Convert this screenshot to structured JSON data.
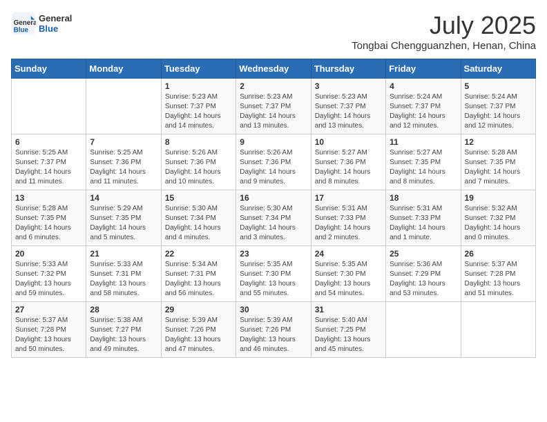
{
  "header": {
    "logo_general": "General",
    "logo_blue": "Blue",
    "month_title": "July 2025",
    "location": "Tongbai Chengguanzhen, Henan, China"
  },
  "weekdays": [
    "Sunday",
    "Monday",
    "Tuesday",
    "Wednesday",
    "Thursday",
    "Friday",
    "Saturday"
  ],
  "weeks": [
    [
      {
        "day": "",
        "info": ""
      },
      {
        "day": "",
        "info": ""
      },
      {
        "day": "1",
        "info": "Sunrise: 5:23 AM\nSunset: 7:37 PM\nDaylight: 14 hours and 14 minutes."
      },
      {
        "day": "2",
        "info": "Sunrise: 5:23 AM\nSunset: 7:37 PM\nDaylight: 14 hours and 13 minutes."
      },
      {
        "day": "3",
        "info": "Sunrise: 5:23 AM\nSunset: 7:37 PM\nDaylight: 14 hours and 13 minutes."
      },
      {
        "day": "4",
        "info": "Sunrise: 5:24 AM\nSunset: 7:37 PM\nDaylight: 14 hours and 12 minutes."
      },
      {
        "day": "5",
        "info": "Sunrise: 5:24 AM\nSunset: 7:37 PM\nDaylight: 14 hours and 12 minutes."
      }
    ],
    [
      {
        "day": "6",
        "info": "Sunrise: 5:25 AM\nSunset: 7:37 PM\nDaylight: 14 hours and 11 minutes."
      },
      {
        "day": "7",
        "info": "Sunrise: 5:25 AM\nSunset: 7:36 PM\nDaylight: 14 hours and 11 minutes."
      },
      {
        "day": "8",
        "info": "Sunrise: 5:26 AM\nSunset: 7:36 PM\nDaylight: 14 hours and 10 minutes."
      },
      {
        "day": "9",
        "info": "Sunrise: 5:26 AM\nSunset: 7:36 PM\nDaylight: 14 hours and 9 minutes."
      },
      {
        "day": "10",
        "info": "Sunrise: 5:27 AM\nSunset: 7:36 PM\nDaylight: 14 hours and 8 minutes."
      },
      {
        "day": "11",
        "info": "Sunrise: 5:27 AM\nSunset: 7:35 PM\nDaylight: 14 hours and 8 minutes."
      },
      {
        "day": "12",
        "info": "Sunrise: 5:28 AM\nSunset: 7:35 PM\nDaylight: 14 hours and 7 minutes."
      }
    ],
    [
      {
        "day": "13",
        "info": "Sunrise: 5:28 AM\nSunset: 7:35 PM\nDaylight: 14 hours and 6 minutes."
      },
      {
        "day": "14",
        "info": "Sunrise: 5:29 AM\nSunset: 7:35 PM\nDaylight: 14 hours and 5 minutes."
      },
      {
        "day": "15",
        "info": "Sunrise: 5:30 AM\nSunset: 7:34 PM\nDaylight: 14 hours and 4 minutes."
      },
      {
        "day": "16",
        "info": "Sunrise: 5:30 AM\nSunset: 7:34 PM\nDaylight: 14 hours and 3 minutes."
      },
      {
        "day": "17",
        "info": "Sunrise: 5:31 AM\nSunset: 7:33 PM\nDaylight: 14 hours and 2 minutes."
      },
      {
        "day": "18",
        "info": "Sunrise: 5:31 AM\nSunset: 7:33 PM\nDaylight: 14 hours and 1 minute."
      },
      {
        "day": "19",
        "info": "Sunrise: 5:32 AM\nSunset: 7:32 PM\nDaylight: 14 hours and 0 minutes."
      }
    ],
    [
      {
        "day": "20",
        "info": "Sunrise: 5:33 AM\nSunset: 7:32 PM\nDaylight: 13 hours and 59 minutes."
      },
      {
        "day": "21",
        "info": "Sunrise: 5:33 AM\nSunset: 7:31 PM\nDaylight: 13 hours and 58 minutes."
      },
      {
        "day": "22",
        "info": "Sunrise: 5:34 AM\nSunset: 7:31 PM\nDaylight: 13 hours and 56 minutes."
      },
      {
        "day": "23",
        "info": "Sunrise: 5:35 AM\nSunset: 7:30 PM\nDaylight: 13 hours and 55 minutes."
      },
      {
        "day": "24",
        "info": "Sunrise: 5:35 AM\nSunset: 7:30 PM\nDaylight: 13 hours and 54 minutes."
      },
      {
        "day": "25",
        "info": "Sunrise: 5:36 AM\nSunset: 7:29 PM\nDaylight: 13 hours and 53 minutes."
      },
      {
        "day": "26",
        "info": "Sunrise: 5:37 AM\nSunset: 7:28 PM\nDaylight: 13 hours and 51 minutes."
      }
    ],
    [
      {
        "day": "27",
        "info": "Sunrise: 5:37 AM\nSunset: 7:28 PM\nDaylight: 13 hours and 50 minutes."
      },
      {
        "day": "28",
        "info": "Sunrise: 5:38 AM\nSunset: 7:27 PM\nDaylight: 13 hours and 49 minutes."
      },
      {
        "day": "29",
        "info": "Sunrise: 5:39 AM\nSunset: 7:26 PM\nDaylight: 13 hours and 47 minutes."
      },
      {
        "day": "30",
        "info": "Sunrise: 5:39 AM\nSunset: 7:26 PM\nDaylight: 13 hours and 46 minutes."
      },
      {
        "day": "31",
        "info": "Sunrise: 5:40 AM\nSunset: 7:25 PM\nDaylight: 13 hours and 45 minutes."
      },
      {
        "day": "",
        "info": ""
      },
      {
        "day": "",
        "info": ""
      }
    ]
  ]
}
